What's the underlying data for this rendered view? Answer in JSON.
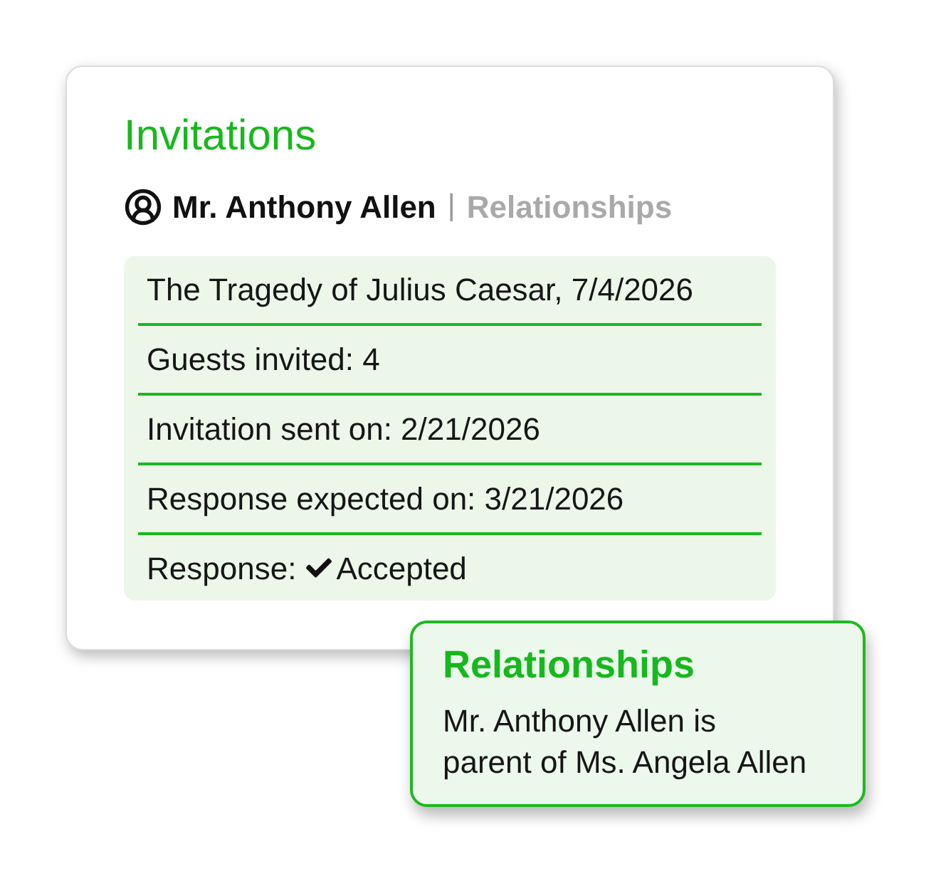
{
  "card": {
    "title": "Invitations",
    "person": {
      "name": "Mr. Anthony Allen"
    },
    "separator": "|",
    "link": {
      "label": "Relationships"
    },
    "details": [
      {
        "kind": "text",
        "text": "The Tragedy of Julius Caesar, 7/4/2026"
      },
      {
        "kind": "text",
        "text": "Guests invited: 4"
      },
      {
        "kind": "text",
        "text": "Invitation sent on: 2/21/2026"
      },
      {
        "kind": "text",
        "text": "Response expected on: 3/21/2026"
      },
      {
        "kind": "status",
        "label": "Response:",
        "value": "Accepted"
      }
    ]
  },
  "popover": {
    "title": "Relationships",
    "text": "Mr. Anthony Allen is parent of Ms. Angela Allen"
  }
}
